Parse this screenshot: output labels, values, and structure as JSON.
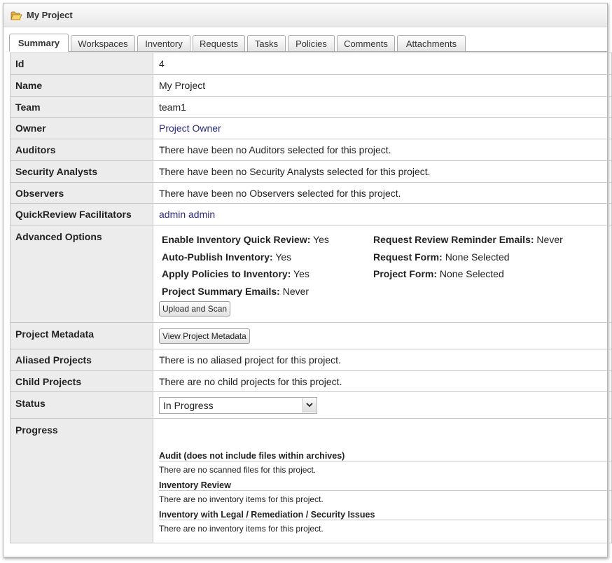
{
  "window": {
    "title": "My Project",
    "icon": "folder-icon"
  },
  "tabs": [
    {
      "label": "Summary",
      "active": true
    },
    {
      "label": "Workspaces"
    },
    {
      "label": "Inventory"
    },
    {
      "label": "Requests"
    },
    {
      "label": "Tasks"
    },
    {
      "label": "Policies"
    },
    {
      "label": "Comments"
    },
    {
      "label": "Attachments"
    }
  ],
  "fields": {
    "id": {
      "label": "Id",
      "value": "4"
    },
    "name": {
      "label": "Name",
      "value": "My Project"
    },
    "team": {
      "label": "Team",
      "value": "team1"
    },
    "owner": {
      "label": "Owner",
      "value": "Project Owner"
    },
    "auditors": {
      "label": "Auditors",
      "value": "There have been no Auditors selected for this project."
    },
    "security_analysts": {
      "label": "Security Analysts",
      "value": "There have been no Security Analysts selected for this project."
    },
    "observers": {
      "label": "Observers",
      "value": "There have been no Observers selected for this project."
    },
    "quickreview": {
      "label": "QuickReview Facilitators",
      "value": "admin admin"
    },
    "advanced": {
      "label": "Advanced Options",
      "col1": [
        {
          "key": "Enable Inventory Quick Review:",
          "value": "Yes"
        },
        {
          "key": "Auto-Publish Inventory:",
          "value": "Yes"
        },
        {
          "key": "Apply Policies to Inventory:",
          "value": "Yes"
        },
        {
          "key": "Project Summary Emails:",
          "value": "Never"
        }
      ],
      "col2": [
        {
          "key": "Request Review Reminder Emails:",
          "value": "Never"
        },
        {
          "key": "Request Form:",
          "value": "None Selected"
        },
        {
          "key": "Project Form:",
          "value": "None Selected"
        }
      ],
      "button": "Upload and Scan"
    },
    "metadata": {
      "label": "Project Metadata",
      "button": "View Project Metadata"
    },
    "aliased": {
      "label": "Aliased Projects",
      "value": "There is no aliased project for this project."
    },
    "child": {
      "label": "Child Projects",
      "value": "There are no child projects for this project."
    },
    "status": {
      "label": "Status",
      "value": "In Progress"
    },
    "progress": {
      "label": "Progress",
      "sections": [
        {
          "title": "Audit (does not include files within archives)",
          "text": "There are no scanned files for this project."
        },
        {
          "title": "Inventory Review",
          "text": "There are no inventory items for this project."
        },
        {
          "title": "Inventory with Legal / Remediation / Security Issues",
          "text": "There are no inventory items for this project."
        }
      ]
    }
  }
}
